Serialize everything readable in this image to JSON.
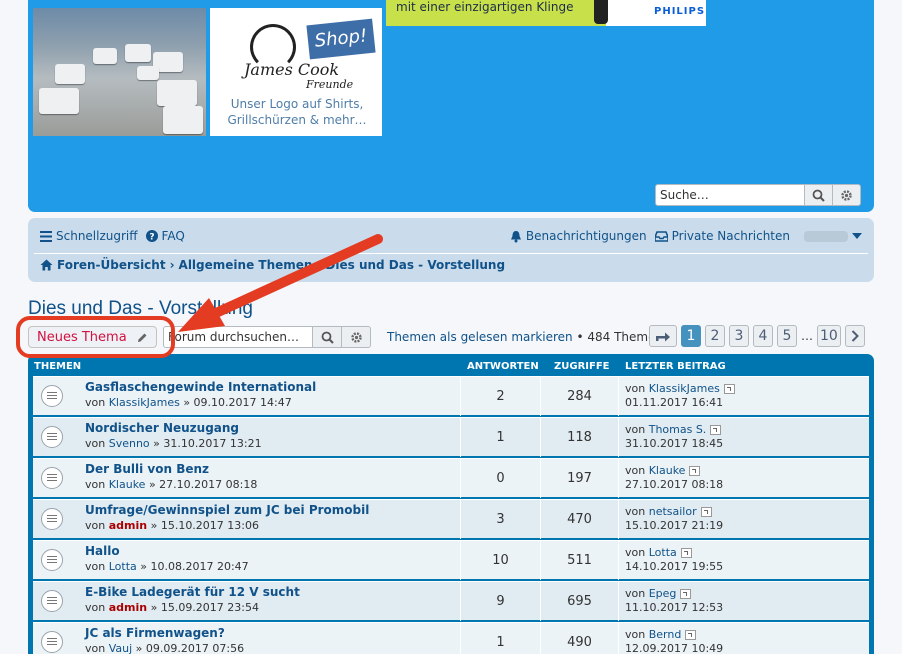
{
  "header": {
    "shop_badge": "Shop!",
    "logo_name": "James Cook",
    "logo_sub": "Freunde",
    "logo_text_line1": "Unser Logo auf Shirts,",
    "logo_text_line2": "Grillschürzen & mehr…",
    "ad_text": "mit einer einzigartigen Klinge",
    "ad_brand": "PHILIPS",
    "search_placeholder": "Suche…"
  },
  "nav": {
    "quicklinks": "Schnellzugriff",
    "faq": "FAQ",
    "notifications": "Benachrichtigungen",
    "private_messages": "Private Nachrichten",
    "breadcrumbs": [
      "Foren-Übersicht",
      "Allgemeine Themen",
      "Dies und Das - Vorstellung"
    ]
  },
  "page": {
    "title": "Dies und Das - Vorstellung",
    "new_topic": "Neues Thema",
    "forum_search_placeholder": "Forum durchsuchen…",
    "mark_read": "Themen als gelesen markieren",
    "topic_count": "• 484 Themen",
    "pages": [
      "1",
      "2",
      "3",
      "4",
      "5"
    ],
    "pages_dots": "…",
    "last_page": "10",
    "active_page": "1"
  },
  "table": {
    "headers": {
      "topics": "THEMEN",
      "replies": "ANTWORTEN",
      "views": "ZUGRIFFE",
      "last_post": "LETZTER BEITRAG"
    },
    "by": "von",
    "rows": [
      {
        "title": "Gasflaschengewinde International",
        "author": "KlassikJames",
        "admin": false,
        "date": "» 09.10.2017 14:47",
        "replies": "2",
        "views": "284",
        "last_author": "KlassikJames",
        "last_date": "01.11.2017 16:41"
      },
      {
        "title": "Nordischer Neuzugang",
        "author": "Svenno",
        "admin": false,
        "date": "» 31.10.2017 13:21",
        "replies": "1",
        "views": "118",
        "last_author": "Thomas S.",
        "last_date": "31.10.2017 18:45"
      },
      {
        "title": "Der Bulli von Benz",
        "author": "Klauke",
        "admin": false,
        "date": "» 27.10.2017 08:18",
        "replies": "0",
        "views": "197",
        "last_author": "Klauke",
        "last_date": "27.10.2017 08:18"
      },
      {
        "title": "Umfrage/Gewinnspiel zum JC bei Promobil",
        "author": "admin",
        "admin": true,
        "date": "» 15.10.2017 13:06",
        "replies": "3",
        "views": "470",
        "last_author": "netsailor",
        "last_date": "15.10.2017 21:19"
      },
      {
        "title": "Hallo",
        "author": "Lotta",
        "admin": false,
        "date": "» 10.08.2017 20:47",
        "replies": "10",
        "views": "511",
        "last_author": "Lotta",
        "last_date": "14.10.2017 19:55"
      },
      {
        "title": "E-Bike Ladegerät für 12 V sucht",
        "author": "admin",
        "admin": true,
        "date": "» 15.09.2017 23:54",
        "replies": "9",
        "views": "695",
        "last_author": "Epeg",
        "last_date": "11.10.2017 12:53"
      },
      {
        "title": "JC als Firmenwagen?",
        "author": "Vauj",
        "admin": false,
        "date": "» 09.09.2017 07:56",
        "replies": "1",
        "views": "490",
        "last_author": "Bernd",
        "last_date": "12.09.2017 10:49"
      }
    ]
  },
  "colors": {
    "header_bg": "#1f9be8",
    "link": "#105289",
    "new_topic_text": "#d31141",
    "annotation": "#e43c22",
    "admin": "#aa0000"
  }
}
